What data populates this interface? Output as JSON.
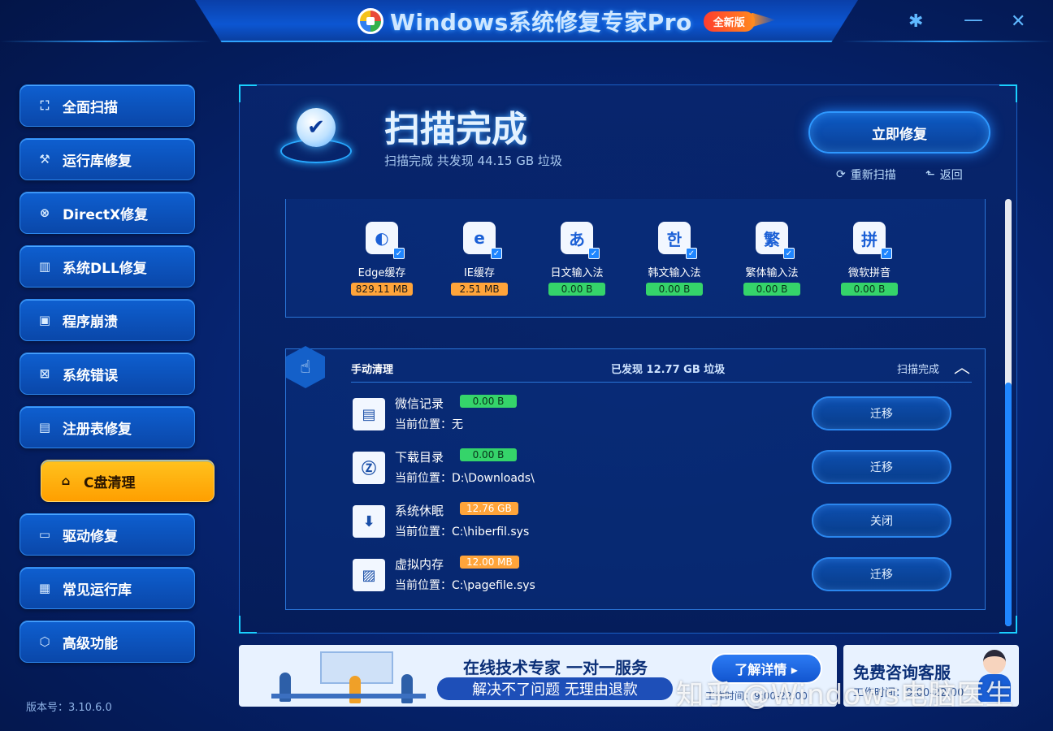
{
  "window": {
    "title": "Windows系统修复专家Pro",
    "badge": "全新版",
    "controls": {
      "settings": "✱",
      "minimize": "—",
      "close": "✕"
    }
  },
  "sidebar": {
    "items": [
      {
        "label": "全面扫描",
        "icon": "scan-icon",
        "glyph": "⛶"
      },
      {
        "label": "运行库修复",
        "icon": "wrench-icon",
        "glyph": "⚒"
      },
      {
        "label": "DirectX修复",
        "icon": "directx-icon",
        "glyph": "⊗"
      },
      {
        "label": "系统DLL修复",
        "icon": "dll-icon",
        "glyph": "▥"
      },
      {
        "label": "程序崩溃",
        "icon": "monitor-icon",
        "glyph": "▣"
      },
      {
        "label": "系统错误",
        "icon": "error-screen-icon",
        "glyph": "⊠"
      },
      {
        "label": "注册表修复",
        "icon": "registry-icon",
        "glyph": "▤"
      },
      {
        "label": "C盘清理",
        "icon": "broom-icon",
        "glyph": "⌂",
        "active": true
      },
      {
        "label": "驱动修复",
        "icon": "driver-icon",
        "glyph": "▭"
      },
      {
        "label": "常见运行库",
        "icon": "library-icon",
        "glyph": "▦"
      },
      {
        "label": "高级功能",
        "icon": "cube-icon",
        "glyph": "⬡"
      }
    ],
    "version": "版本号：3.10.6.0"
  },
  "scan": {
    "title": "扫描完成",
    "subtitle": "扫描完成 共发现 44.15 GB 垃圾",
    "fix_button": "立即修复",
    "rescan": "重新扫描",
    "back": "返回"
  },
  "cache_items": [
    {
      "name": "Edge缓存",
      "size": "829.11 MB",
      "level": "orange",
      "icon": "edge-icon",
      "glyph": "◐"
    },
    {
      "name": "IE缓存",
      "size": "2.51 MB",
      "level": "orange",
      "icon": "ie-icon",
      "glyph": "e"
    },
    {
      "name": "日文输入法",
      "size": "0.00 B",
      "level": "green",
      "icon": "japanese-ime-icon",
      "glyph": "あ"
    },
    {
      "name": "韩文输入法",
      "size": "0.00 B",
      "level": "green",
      "icon": "korean-ime-icon",
      "glyph": "한"
    },
    {
      "name": "繁体输入法",
      "size": "0.00 B",
      "level": "green",
      "icon": "traditional-ime-icon",
      "glyph": "繁"
    },
    {
      "name": "微软拼音",
      "size": "0.00 B",
      "level": "green",
      "icon": "pinyin-ime-icon",
      "glyph": "拼"
    }
  ],
  "manual": {
    "heading": "手动清理",
    "found": "已发现 12.77 GB 垃圾",
    "status": "扫描完成",
    "location_label": "当前位置：",
    "items": [
      {
        "name": "微信记录",
        "size": "0.00 B",
        "level": "green",
        "location": "无",
        "action": "迁移",
        "icon": "wechat-record-icon",
        "glyph": "▤"
      },
      {
        "name": "下载目录",
        "size": "0.00 B",
        "level": "green",
        "location": "D:\\Downloads\\",
        "action": "迁移",
        "icon": "download-dir-icon",
        "glyph": "Ⓩ"
      },
      {
        "name": "系统休眠",
        "size": "12.76 GB",
        "level": "orange",
        "location": "C:\\hiberfil.sys",
        "action": "关闭",
        "icon": "hibernate-icon",
        "glyph": "⬇"
      },
      {
        "name": "虚拟内存",
        "size": "12.00 MB",
        "level": "orange",
        "location": "C:\\pagefile.sys",
        "action": "迁移",
        "icon": "virtual-memory-icon",
        "glyph": "▨"
      }
    ]
  },
  "banner_left": {
    "title": "在线技术专家 一对一服务",
    "subtitle": "解决不了问题 无理由退款",
    "button": "了解详情 ▸",
    "hours": "工作时间：9:00-22:00"
  },
  "banner_right": {
    "title": "免费咨询客服",
    "subtitle": "工作时间：9:00-22:00"
  },
  "watermark": "知乎 @Windows电脑医生",
  "colors": {
    "accent": "#1f86ff",
    "active_nav": "#ffb20f",
    "size_orange": "#ffa43a",
    "size_green": "#35d46a"
  }
}
